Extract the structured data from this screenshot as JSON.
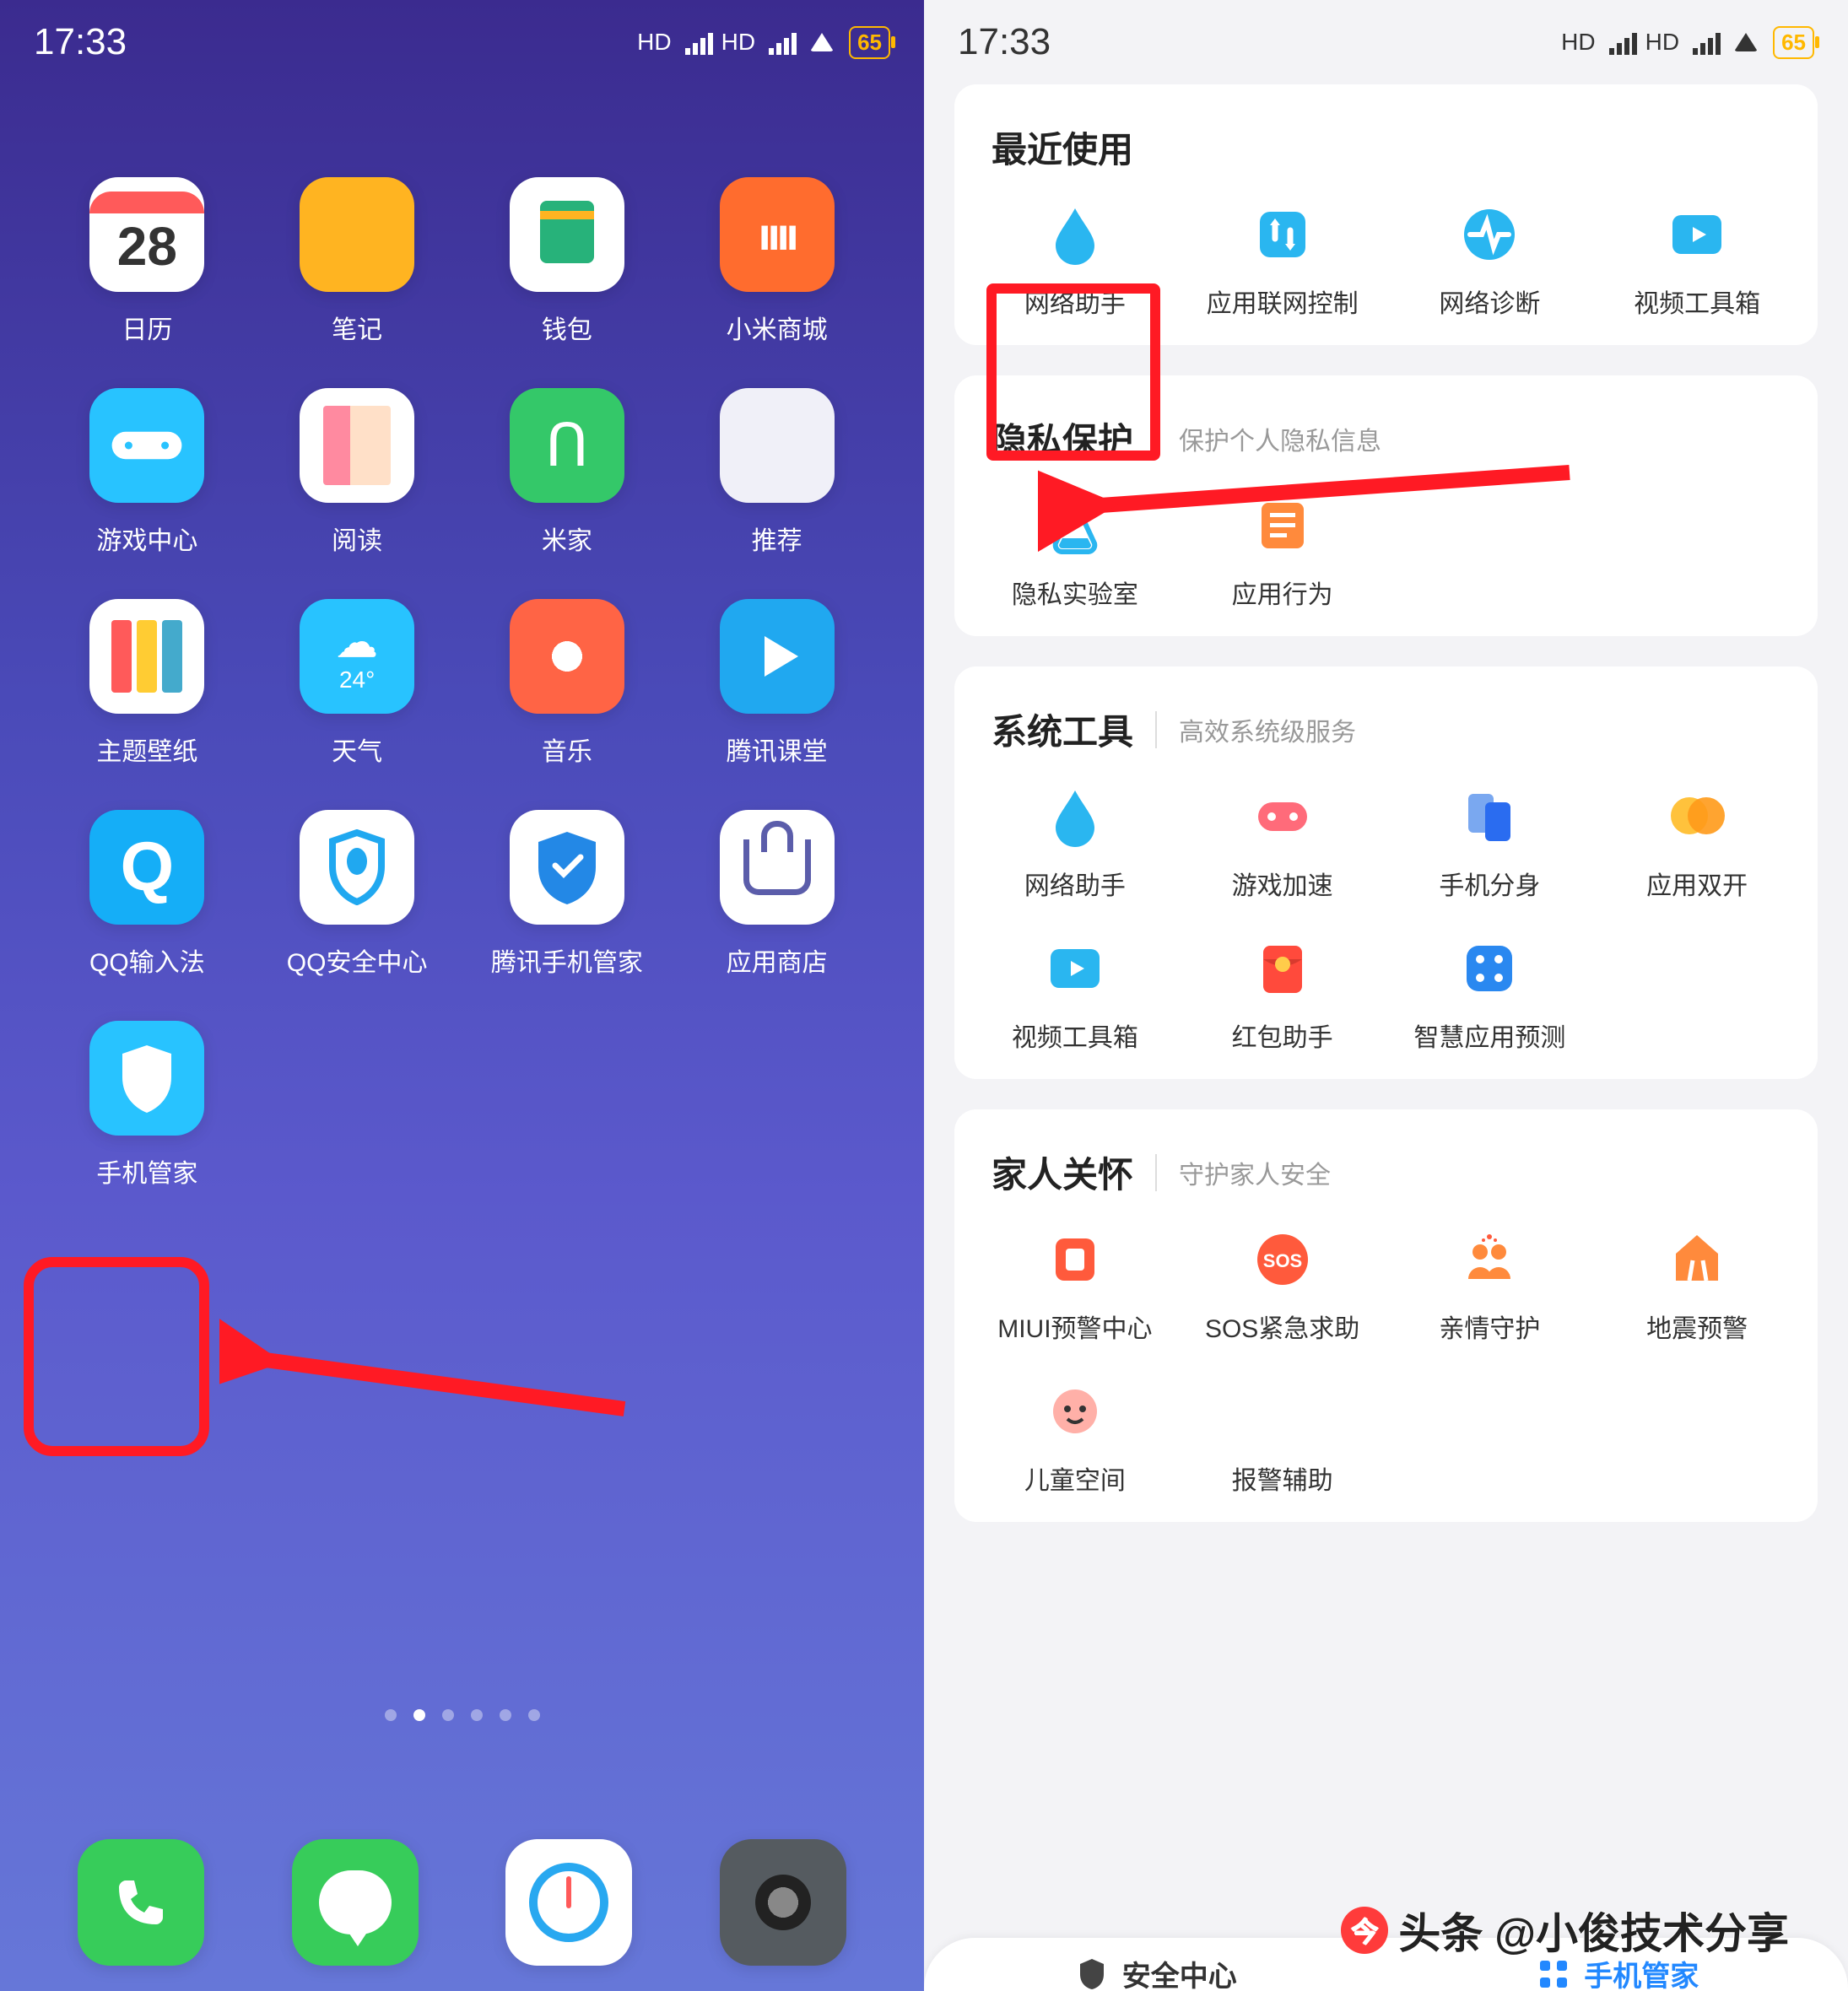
{
  "status": {
    "time": "17:33",
    "hd": "HD",
    "battery": "65"
  },
  "home": {
    "apps": [
      {
        "label": "日历",
        "badge": "28",
        "icon": "calendar"
      },
      {
        "label": "笔记",
        "icon": "notes"
      },
      {
        "label": "钱包",
        "icon": "wallet"
      },
      {
        "label": "小米商城",
        "icon": "mi-store",
        "text": "ıııı"
      },
      {
        "label": "游戏中心",
        "icon": "game"
      },
      {
        "label": "阅读",
        "icon": "read"
      },
      {
        "label": "米家",
        "icon": "mijia",
        "text": "ᑎ"
      },
      {
        "label": "推荐",
        "icon": "folder"
      },
      {
        "label": "主题壁纸",
        "icon": "theme"
      },
      {
        "label": "天气",
        "icon": "weather",
        "temp": "24°"
      },
      {
        "label": "音乐",
        "icon": "music"
      },
      {
        "label": "腾讯课堂",
        "icon": "course"
      },
      {
        "label": "QQ输入法",
        "icon": "qqinput",
        "text": "Q"
      },
      {
        "label": "QQ安全中心",
        "icon": "qqsec"
      },
      {
        "label": "腾讯手机管家",
        "icon": "tencent-guard"
      },
      {
        "label": "应用商店",
        "icon": "app-store"
      },
      {
        "label": "手机管家",
        "icon": "phone-guard"
      }
    ],
    "dock": [
      {
        "label": "电话",
        "icon": "phone"
      },
      {
        "label": "信息",
        "icon": "messages"
      },
      {
        "label": "浏览器",
        "icon": "browser"
      },
      {
        "label": "相机",
        "icon": "camera"
      }
    ]
  },
  "manager": {
    "sections": [
      {
        "title": "最近使用",
        "sub": "",
        "tools": [
          {
            "label": "网络助手",
            "icon": "drop"
          },
          {
            "label": "应用联网控制",
            "icon": "netctl"
          },
          {
            "label": "网络诊断",
            "icon": "diag"
          },
          {
            "label": "视频工具箱",
            "icon": "video"
          }
        ]
      },
      {
        "title": "隐私保护",
        "sub": "保护个人隐私信息",
        "tools": [
          {
            "label": "隐私实验室",
            "icon": "lab"
          },
          {
            "label": "应用行为",
            "icon": "behavior"
          }
        ]
      },
      {
        "title": "系统工具",
        "sub": "高效系统级服务",
        "tools": [
          {
            "label": "网络助手",
            "icon": "drop"
          },
          {
            "label": "游戏加速",
            "icon": "boost"
          },
          {
            "label": "手机分身",
            "icon": "clone"
          },
          {
            "label": "应用双开",
            "icon": "dual"
          },
          {
            "label": "视频工具箱",
            "icon": "video"
          },
          {
            "label": "红包助手",
            "icon": "red"
          },
          {
            "label": "智慧应用预测",
            "icon": "predict"
          }
        ]
      },
      {
        "title": "家人关怀",
        "sub": "守护家人安全",
        "tools": [
          {
            "label": "MIUI预警中心",
            "icon": "alert"
          },
          {
            "label": "SOS紧急求助",
            "icon": "sos"
          },
          {
            "label": "亲情守护",
            "icon": "family"
          },
          {
            "label": "地震预警",
            "icon": "quake"
          }
        ]
      }
    ],
    "partial": [
      {
        "label": "儿童空间",
        "icon": "child"
      },
      {
        "label": "报警辅助",
        "icon": "police"
      }
    ],
    "tabs": [
      {
        "label": "安全中心",
        "active": false
      },
      {
        "label": "手机管家",
        "active": true
      }
    ]
  },
  "watermark": "头条 @小俊技术分享"
}
